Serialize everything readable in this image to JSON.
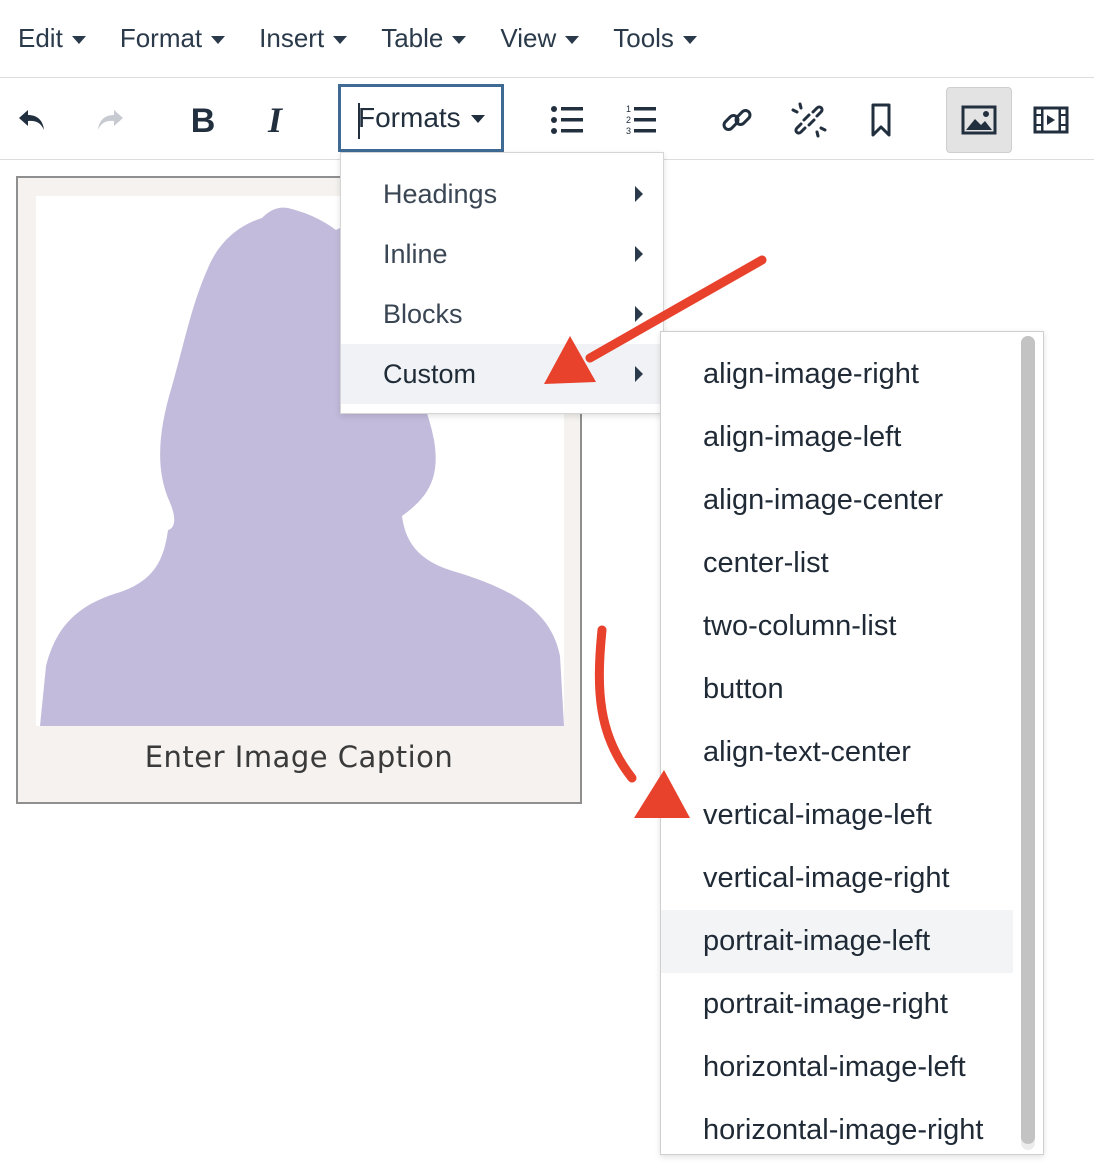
{
  "menubar": {
    "items": [
      {
        "label": "Edit"
      },
      {
        "label": "Format"
      },
      {
        "label": "Insert"
      },
      {
        "label": "Table"
      },
      {
        "label": "View"
      },
      {
        "label": "Tools"
      }
    ]
  },
  "toolbar": {
    "formats_label": "Formats",
    "buttons": [
      {
        "icon": "undo-icon"
      },
      {
        "icon": "redo-icon"
      },
      {
        "icon": "bold-icon"
      },
      {
        "icon": "italic-icon"
      },
      {
        "icon": "bullet-list-icon"
      },
      {
        "icon": "numbered-list-icon"
      },
      {
        "icon": "link-icon"
      },
      {
        "icon": "unlink-icon"
      },
      {
        "icon": "bookmark-icon"
      },
      {
        "icon": "image-icon",
        "active": true
      },
      {
        "icon": "media-icon"
      }
    ]
  },
  "figure": {
    "caption": "Enter Image Caption"
  },
  "formats_dropdown": {
    "items": [
      {
        "label": "Headings"
      },
      {
        "label": "Inline"
      },
      {
        "label": "Blocks"
      },
      {
        "label": "Custom",
        "selected": true
      }
    ]
  },
  "custom_submenu": {
    "items": [
      {
        "label": "align-image-right"
      },
      {
        "label": "align-image-left"
      },
      {
        "label": "align-image-center"
      },
      {
        "label": "center-list"
      },
      {
        "label": "two-column-list"
      },
      {
        "label": "button"
      },
      {
        "label": "align-text-center"
      },
      {
        "label": "vertical-image-left"
      },
      {
        "label": "vertical-image-right"
      },
      {
        "label": "portrait-image-left",
        "hover": true
      },
      {
        "label": "portrait-image-right"
      },
      {
        "label": "horizontal-image-left"
      },
      {
        "label": "horizontal-image-right"
      }
    ]
  },
  "colors": {
    "accent_border": "#3e6a94",
    "annotation_arrow": "#e8412c",
    "silhouette": "#c3bbdb"
  }
}
